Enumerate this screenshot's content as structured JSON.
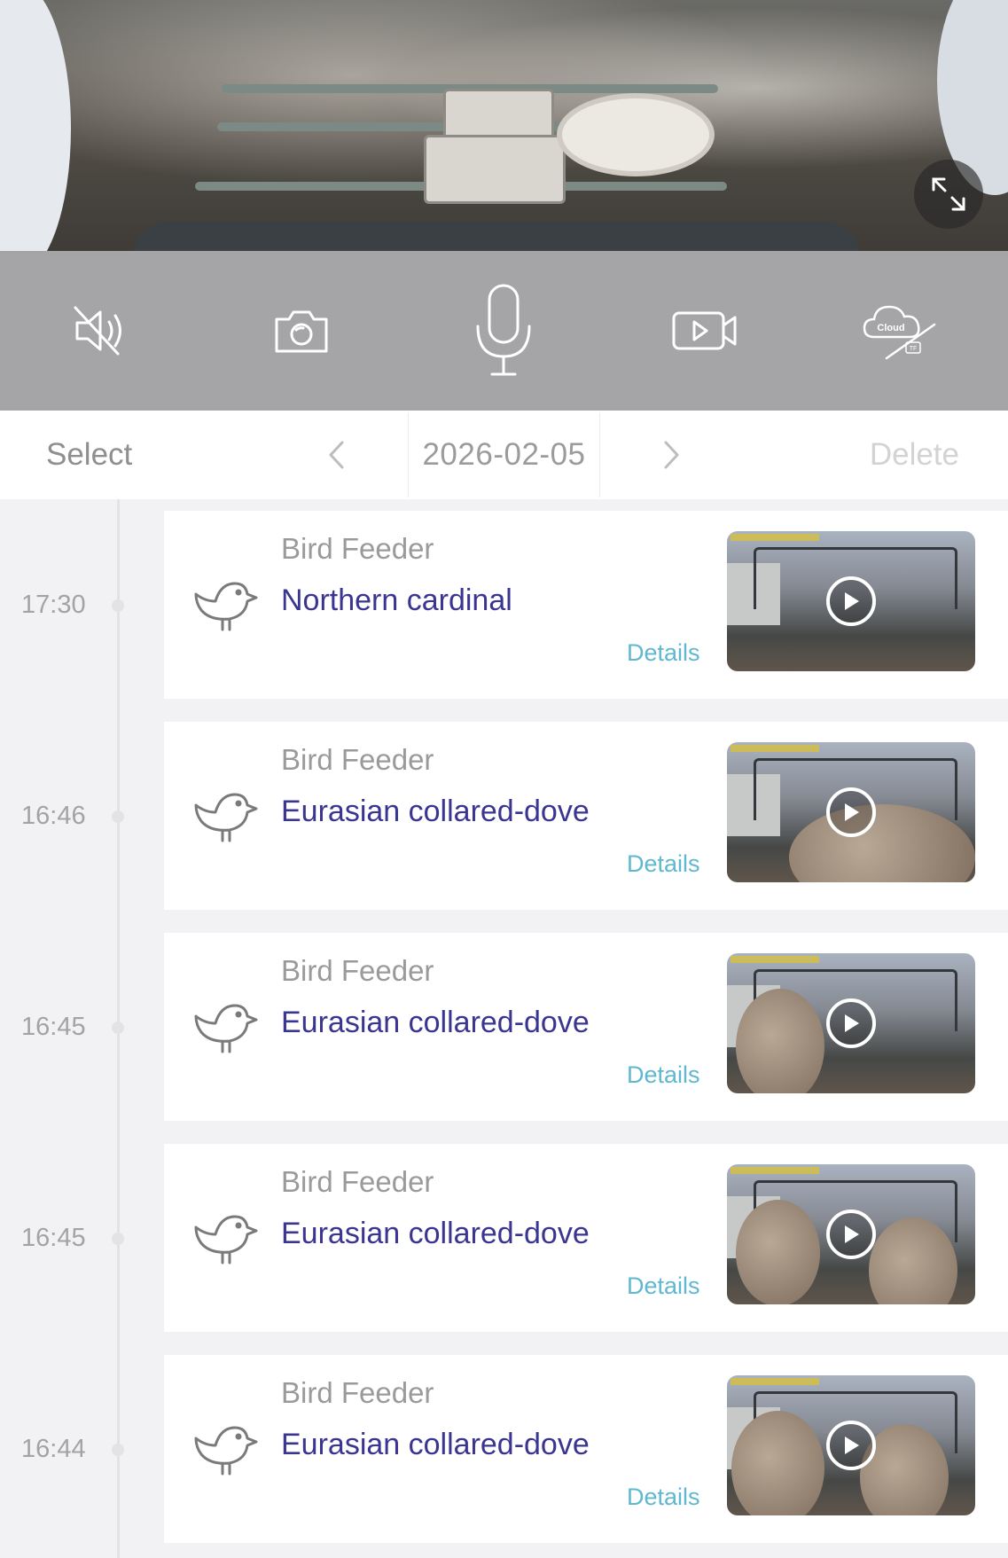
{
  "live_view": {
    "fullscreen_icon": "expand-icon"
  },
  "controls": [
    {
      "name": "mute-toggle",
      "icon": "speaker-muted-icon"
    },
    {
      "name": "snapshot",
      "icon": "camera-icon"
    },
    {
      "name": "talk",
      "icon": "microphone-icon"
    },
    {
      "name": "record",
      "icon": "video-camera-icon"
    },
    {
      "name": "cloud-storage",
      "icon": "cloud-tf-icon",
      "label": "Cloud",
      "sublabel": "TF"
    }
  ],
  "date_nav": {
    "select_label": "Select",
    "date": "2026-02-05",
    "delete_label": "Delete"
  },
  "events": [
    {
      "time": "17:30",
      "device": "Bird Feeder",
      "species": "Northern cardinal",
      "details_label": "Details"
    },
    {
      "time": "16:46",
      "device": "Bird Feeder",
      "species": "Eurasian collared-dove",
      "details_label": "Details"
    },
    {
      "time": "16:45",
      "device": "Bird Feeder",
      "species": "Eurasian collared-dove",
      "details_label": "Details"
    },
    {
      "time": "16:45",
      "device": "Bird Feeder",
      "species": "Eurasian collared-dove",
      "details_label": "Details"
    },
    {
      "time": "16:44",
      "device": "Bird Feeder",
      "species": "Eurasian collared-dove",
      "details_label": "Details"
    }
  ],
  "colors": {
    "species_text": "#3a3591",
    "details_link": "#5fb8cf",
    "control_bar": "#a5a5a7"
  }
}
